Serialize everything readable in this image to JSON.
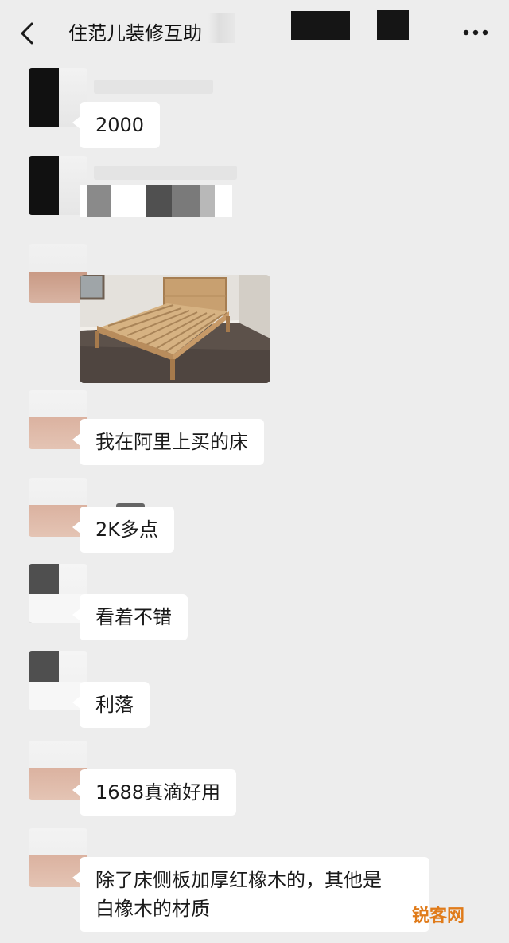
{
  "header": {
    "title": "住范儿装修互助",
    "back_icon": "chevron-left-icon",
    "more_icon": "more-dots-icon"
  },
  "messages": [
    {
      "type": "text",
      "text": "2000"
    },
    {
      "type": "censored"
    },
    {
      "type": "image",
      "alt": "photo of a wooden bed frame with slatted base"
    },
    {
      "type": "text",
      "text": "我在阿里上买的床"
    },
    {
      "type": "text",
      "text": "2K多点"
    },
    {
      "type": "text",
      "text": "看着不错"
    },
    {
      "type": "text",
      "text": "利落"
    },
    {
      "type": "text",
      "text": "1688真滴好用"
    },
    {
      "type": "text",
      "text": "除了床侧板加厚红橡木的，其他是\n白橡木的材质"
    }
  ],
  "watermark": {
    "text": "锐客网"
  },
  "colors": {
    "background": "#ededed",
    "bubble": "#ffffff",
    "watermark": "#e07b1a"
  }
}
